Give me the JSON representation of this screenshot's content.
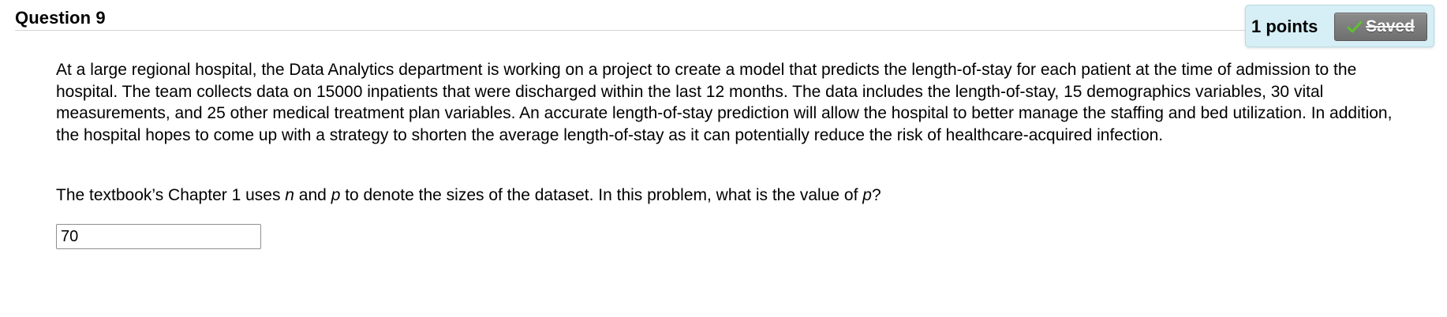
{
  "question": {
    "title": "Question 9",
    "points": "1 points",
    "saved_label": "Saved",
    "body": "At a large regional hospital, the Data Analytics department is working on a project to create a model that predicts the length-of-stay for each patient at the time of admission to the hospital. The team collects data on 15000 inpatients that were discharged within the last 12 months. The data includes the length-of-stay, 15 demographics variables, 30 vital measurements, and 25 other medical treatment plan variables.  An accurate length-of-stay prediction will allow the hospital to better manage the staffing and bed utilization. In addition, the hospital hopes to come up with a strategy to shorten the average length-of-stay as it can potentially reduce the risk of healthcare-acquired infection.",
    "prompt": {
      "part1": "The textbook’s Chapter 1 uses ",
      "var_n": "n",
      "part2": " and ",
      "var_p": "p",
      "part3": " to denote the sizes of the dataset. In this problem, what is the value of ",
      "var_p2": "p",
      "part4": "?"
    },
    "answer_value": "70"
  },
  "colors": {
    "points_box_bg": "#d6eef5",
    "saved_button_bg": "#7d7d7d",
    "check_green": "#5cc22e"
  },
  "icons": {
    "saved_check": "check-icon"
  }
}
